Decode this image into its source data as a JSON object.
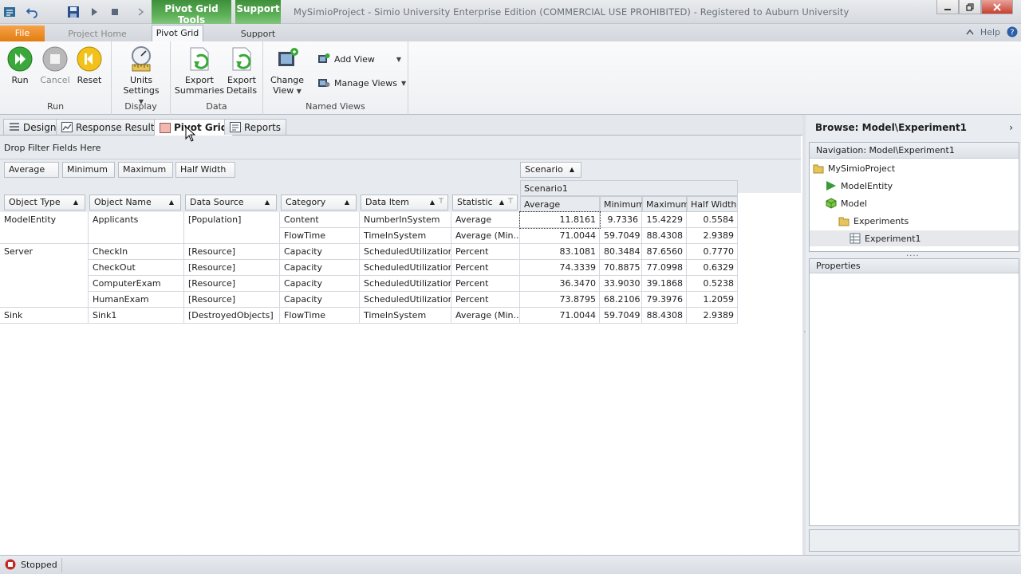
{
  "titlebar": {
    "contextual_tools": "Pivot Grid Tools",
    "contextual_support": "Support",
    "title": "MySimioProject - Simio University Enterprise Edition (COMMERCIAL USE PROHIBITED) - Registered to Auburn University"
  },
  "tabs": {
    "file": "File",
    "project_home": "Project Home",
    "pivot_grid": "Pivot Grid",
    "support": "Support",
    "help": "Help"
  },
  "ribbon": {
    "run_group": {
      "label": "Run",
      "run": "Run",
      "cancel": "Cancel",
      "reset": "Reset"
    },
    "display_group": {
      "label": "Display",
      "units_line1": "Units",
      "units_line2": "Settings"
    },
    "data_group": {
      "label": "Data",
      "export_summaries_1": "Export",
      "export_summaries_2": "Summaries",
      "export_details_1": "Export",
      "export_details_2": "Details"
    },
    "views_group": {
      "label": "Named Views",
      "change_view_1": "Change",
      "change_view_2": "View",
      "add_view": "Add View",
      "manage_views": "Manage Views"
    }
  },
  "doc_tabs": [
    "Design",
    "Response Results",
    "Pivot Grid",
    "Reports"
  ],
  "pivot": {
    "filter_hint": "Drop Filter Fields Here",
    "data_fields": [
      "Average",
      "Minimum",
      "Maximum",
      "Half Width"
    ],
    "column_field": "Scenario",
    "row_fields": [
      "Object Type",
      "Object Name",
      "Data Source",
      "Category",
      "Data Item",
      "Statistic"
    ],
    "scenario_name": "Scenario1",
    "value_headers": [
      "Average",
      "Minimum",
      "Maximum",
      "Half Width"
    ],
    "rows": [
      {
        "type": "ModelEntity",
        "name": "Applicants",
        "source": "[Population]",
        "category": "Content",
        "item": "NumberInSystem",
        "stat": "Average",
        "values": [
          "11.8161",
          "9.7336",
          "15.4229",
          "0.5584"
        ]
      },
      {
        "type": "",
        "name": "",
        "source": "",
        "category": "FlowTime",
        "item": "TimeInSystem",
        "stat": "Average (Min...",
        "values": [
          "71.0044",
          "59.7049",
          "88.4308",
          "2.9389"
        ]
      },
      {
        "type": "Server",
        "name": "CheckIn",
        "source": "[Resource]",
        "category": "Capacity",
        "item": "ScheduledUtilization",
        "stat": "Percent",
        "values": [
          "83.1081",
          "80.3484",
          "87.6560",
          "0.7770"
        ]
      },
      {
        "type": "",
        "name": "CheckOut",
        "source": "[Resource]",
        "category": "Capacity",
        "item": "ScheduledUtilization",
        "stat": "Percent",
        "values": [
          "74.3339",
          "70.8875",
          "77.0998",
          "0.6329"
        ]
      },
      {
        "type": "",
        "name": "ComputerExam",
        "source": "[Resource]",
        "category": "Capacity",
        "item": "ScheduledUtilization",
        "stat": "Percent",
        "values": [
          "36.3470",
          "33.9030",
          "39.1868",
          "0.5238"
        ]
      },
      {
        "type": "",
        "name": "HumanExam",
        "source": "[Resource]",
        "category": "Capacity",
        "item": "ScheduledUtilization",
        "stat": "Percent",
        "values": [
          "73.8795",
          "68.2106",
          "79.3976",
          "1.2059"
        ]
      },
      {
        "type": "Sink",
        "name": "Sink1",
        "source": "[DestroyedObjects]",
        "category": "FlowTime",
        "item": "TimeInSystem",
        "stat": "Average (Min...",
        "values": [
          "71.0044",
          "59.7049",
          "88.4308",
          "2.9389"
        ]
      }
    ]
  },
  "right_panel": {
    "browse_title": "Browse: Model\\Experiment1",
    "nav_title": "Navigation: Model\\Experiment1",
    "tree": [
      "MySimioProject",
      "ModelEntity",
      "Model",
      "Experiments",
      "Experiment1"
    ],
    "properties_title": "Properties"
  },
  "status": {
    "text": "Stopped"
  },
  "colors": {
    "accent_green": "#4ca046",
    "file_orange": "#e88a20",
    "stop_red": "#c62828"
  }
}
